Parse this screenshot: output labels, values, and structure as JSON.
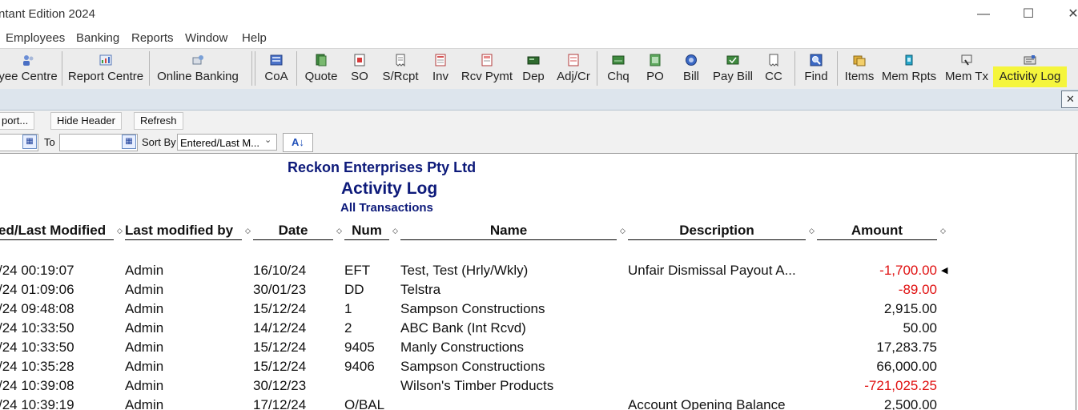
{
  "window": {
    "title": "ntant Edition 2024",
    "controls": {
      "minimize": "—",
      "maximize": "☐",
      "close": "✕"
    }
  },
  "menu": [
    "Employees",
    "Banking",
    "Reports",
    "Window",
    "Help"
  ],
  "toolbar": [
    {
      "label": "yee Centre",
      "icon": "employee-centre-icon"
    },
    {
      "label": "Report Centre",
      "icon": "report-centre-icon"
    },
    {
      "label": "Online Banking",
      "icon": "online-banking-icon"
    },
    {
      "label": "CoA",
      "icon": "chart-of-accounts-icon"
    },
    {
      "label": "Quote",
      "icon": "quote-icon"
    },
    {
      "label": "SO",
      "icon": "sales-order-icon"
    },
    {
      "label": "S/Rcpt",
      "icon": "sales-receipt-icon"
    },
    {
      "label": "Inv",
      "icon": "invoice-icon"
    },
    {
      "label": "Rcv Pymt",
      "icon": "receive-payment-icon"
    },
    {
      "label": "Dep",
      "icon": "deposit-icon"
    },
    {
      "label": "Adj/Cr",
      "icon": "adjustment-credit-icon"
    },
    {
      "label": "Chq",
      "icon": "cheque-icon"
    },
    {
      "label": "PO",
      "icon": "purchase-order-icon"
    },
    {
      "label": "Bill",
      "icon": "bill-icon"
    },
    {
      "label": "Pay Bill",
      "icon": "pay-bill-icon"
    },
    {
      "label": "CC",
      "icon": "credit-card-icon"
    },
    {
      "label": "Find",
      "icon": "find-icon"
    },
    {
      "label": "Items",
      "icon": "items-icon"
    },
    {
      "label": "Mem Rpts",
      "icon": "memorised-reports-icon"
    },
    {
      "label": "Mem Tx",
      "icon": "memorised-transactions-icon"
    },
    {
      "label": "Activity Log",
      "icon": "activity-log-icon"
    }
  ],
  "inner_window": {
    "close": "✕"
  },
  "report_buttons": [
    "port...",
    "Hide Header",
    "Refresh"
  ],
  "filters": {
    "to_label": "To",
    "sort_by_label": "Sort By",
    "sort_by_value": "Entered/Last M...",
    "sort_order_glyph": "A↓"
  },
  "report": {
    "company": "Reckon Enterprises Pty Ltd",
    "title": "Activity Log",
    "subtitle": "All Transactions",
    "columns": [
      "ed/Last Modified",
      "Last modified by",
      "Date",
      "Num",
      "Name",
      "Description",
      "Amount"
    ],
    "rows": [
      {
        "modified": "/24 00:19:07",
        "by": "Admin",
        "date": "16/10/24",
        "num": "EFT",
        "name": "Test, Test (Hrly/Wkly)",
        "description": "Unfair Dismissal Payout A...",
        "amount": "-1,700.00",
        "negative": true
      },
      {
        "modified": "/24 01:09:06",
        "by": "Admin",
        "date": "30/01/23",
        "num": "DD",
        "name": "Telstra",
        "description": "",
        "amount": "-89.00",
        "negative": true
      },
      {
        "modified": "/24 09:48:08",
        "by": "Admin",
        "date": "15/12/24",
        "num": "1",
        "name": "Sampson Constructions",
        "description": "",
        "amount": "2,915.00",
        "negative": false
      },
      {
        "modified": "/24 10:33:50",
        "by": "Admin",
        "date": "14/12/24",
        "num": "2",
        "name": "ABC Bank (Int Rcvd)",
        "description": "",
        "amount": "50.00",
        "negative": false
      },
      {
        "modified": "/24 10:33:50",
        "by": "Admin",
        "date": "15/12/24",
        "num": "9405",
        "name": "Manly Constructions",
        "description": "",
        "amount": "17,283.75",
        "negative": false
      },
      {
        "modified": "/24 10:35:28",
        "by": "Admin",
        "date": "15/12/24",
        "num": "9406",
        "name": "Sampson Constructions",
        "description": "",
        "amount": "66,000.00",
        "negative": false
      },
      {
        "modified": "/24 10:39:08",
        "by": "Admin",
        "date": "30/12/23",
        "num": "",
        "name": "Wilson's Timber Products",
        "description": "",
        "amount": "-721,025.25",
        "negative": true
      },
      {
        "modified": "/24 10:39:19",
        "by": "Admin",
        "date": "17/12/24",
        "num": "O/BAL",
        "name": "",
        "description": "Account Opening Balance",
        "amount": "2,500.00",
        "negative": false
      }
    ],
    "selected_row_marker": "◀"
  }
}
